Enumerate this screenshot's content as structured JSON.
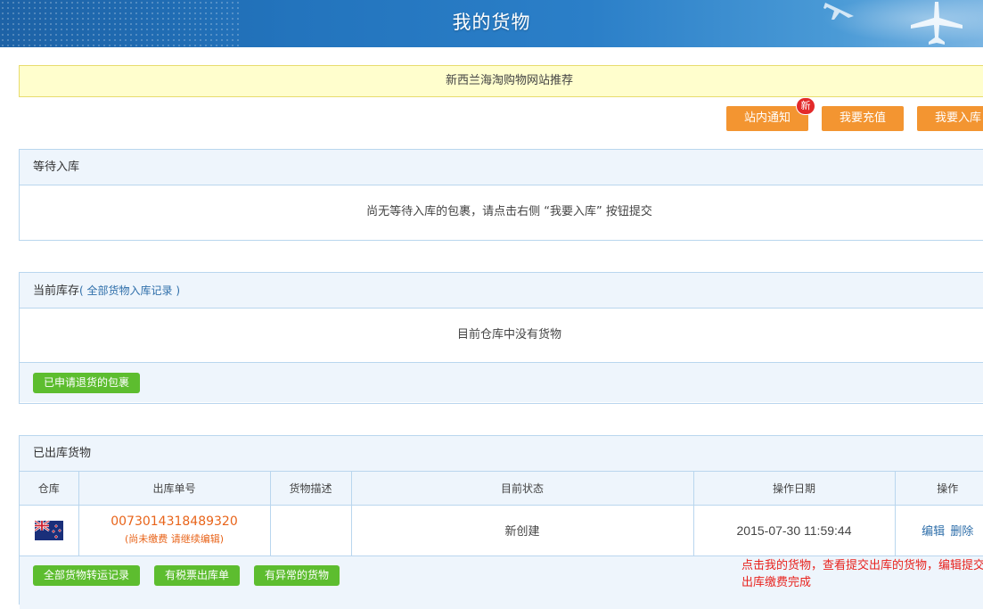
{
  "header": {
    "title": "我的货物"
  },
  "notice": {
    "text": "新西兰海淘购物网站推荐"
  },
  "actions": {
    "site_notice": "站内通知",
    "new_badge": "新",
    "recharge": "我要充值",
    "inbound": "我要入库"
  },
  "pending": {
    "title": "等待入库",
    "empty_text": "尚无等待入库的包裹，请点击右侧 “我要入库” 按钮提交"
  },
  "inventory": {
    "title": "当前库存",
    "link_text": "( 全部货物入库记录 )",
    "empty_text": "目前仓库中没有货物",
    "returned_button": "已申请退货的包裹"
  },
  "shipped": {
    "title": "已出库货物",
    "columns": [
      "仓库",
      "出库单号",
      "货物描述",
      "目前状态",
      "操作日期",
      "操作"
    ],
    "rows": [
      {
        "warehouse_flag": "nz-flag-icon",
        "order_no": "0073014318489320",
        "payment_note": "(尚未缴费 请继续编辑)",
        "description": "",
        "status": "新创建",
        "date": "2015-07-30 11:59:44",
        "edit": "编辑",
        "delete": "删除"
      }
    ],
    "footer_buttons": [
      "全部货物转运记录",
      "有税票出库单",
      "有异常的货物"
    ]
  },
  "annotation": {
    "text": "点击我的货物，查看提交出库的货物，编辑提交出库缴费完成"
  },
  "colors": {
    "header_blue": "#2374bd",
    "orange": "#f39531",
    "green": "#5dbd2f",
    "panel_border": "#b9d6ee",
    "notice_bg": "#fffecd",
    "order_orange": "#e8641a",
    "tip_red": "#e8231e"
  }
}
